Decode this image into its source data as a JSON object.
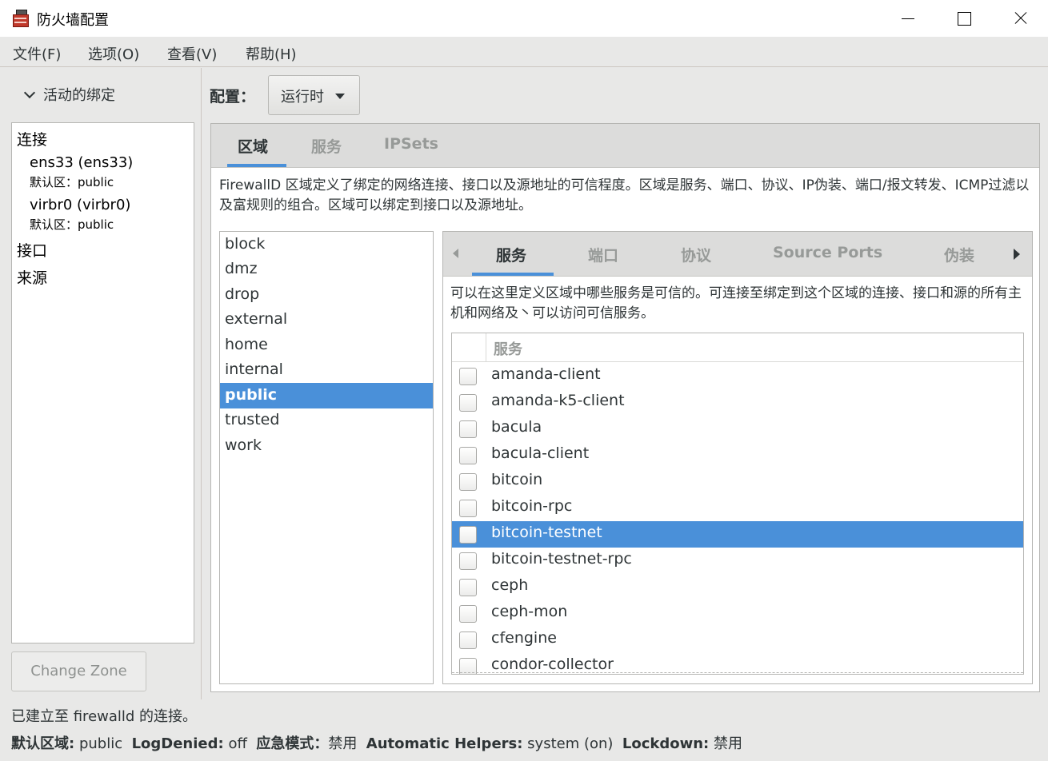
{
  "window": {
    "title": "防火墙配置"
  },
  "menu": [
    "文件(F)",
    "选项(O)",
    "查看(V)",
    "帮助(H)"
  ],
  "left": {
    "header": "活动的绑定",
    "connections_label": "连接",
    "connections": [
      {
        "name": "ens33 (ens33)",
        "zone": "默认区：public"
      },
      {
        "name": "virbr0 (virbr0)",
        "zone": "默认区：public"
      }
    ],
    "interfaces_label": "接口",
    "sources_label": "来源",
    "change_zone_button": "Change Zone"
  },
  "config": {
    "label": "配置：",
    "value": "运行时"
  },
  "tabs": [
    "区域",
    "服务",
    "IPSets"
  ],
  "zone_desc": "FirewallD 区域定义了绑定的网络连接、接口以及源地址的可信程度。区域是服务、端口、协议、IP伪装、端口/报文转发、ICMP过滤以及富规则的组合。区域可以绑定到接口以及源地址。",
  "zones": [
    "block",
    "dmz",
    "drop",
    "external",
    "home",
    "internal",
    "public",
    "trusted",
    "work"
  ],
  "selected_zone_index": 6,
  "inner_tabs": [
    "服务",
    "端口",
    "协议",
    "Source Ports",
    "伪装"
  ],
  "services_desc": "可以在这里定义区域中哪些服务是可信的。可连接至绑定到这个区域的连接、接口和源的所有主机和网络及丶可以访问可信服务。",
  "services_header": "服务",
  "services": [
    "amanda-client",
    "amanda-k5-client",
    "bacula",
    "bacula-client",
    "bitcoin",
    "bitcoin-rpc",
    "bitcoin-testnet",
    "bitcoin-testnet-rpc",
    "ceph",
    "ceph-mon",
    "cfengine",
    "condor-collector"
  ],
  "selected_service_index": 6,
  "status": {
    "connection": "已建立至 firewalld 的连接。",
    "default_zone_label": "默认区域:",
    "default_zone": "public",
    "logdenied_label": "LogDenied:",
    "logdenied": "off",
    "panic_label": "应急模式：",
    "panic": "禁用",
    "helpers_label": "Automatic Helpers:",
    "helpers": "system (on)",
    "lockdown_label": "Lockdown:",
    "lockdown": "禁用"
  },
  "colors": {
    "accent": "#4a90d9",
    "background": "#e8e8e7"
  }
}
